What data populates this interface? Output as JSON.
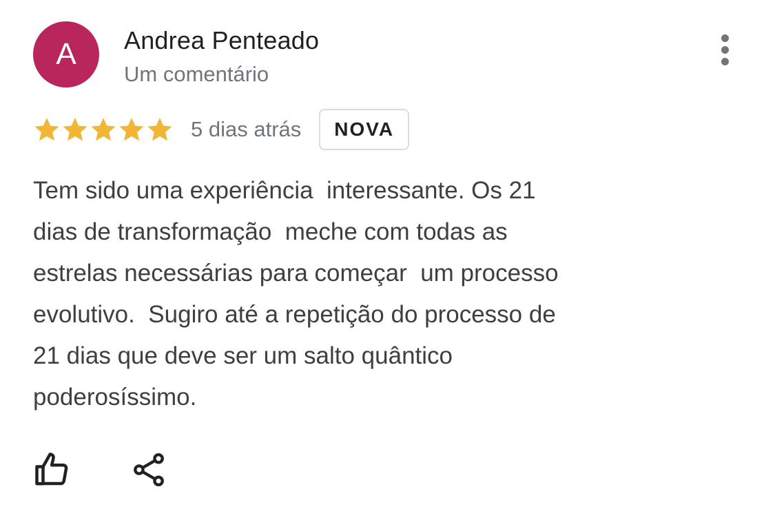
{
  "review": {
    "avatar_letter": "A",
    "author_name": "Andrea Penteado",
    "author_subtitle": "Um comentário",
    "rating": 5,
    "rating_max": 5,
    "date": "5 dias atrás",
    "badge": "NOVA",
    "text": "Tem sido uma experiência  interessante. Os 21\ndias de transformação  meche com todas as\nestrelas necessárias para começar  um processo\nevolutivo.  Sugiro até a repetição do processo de\n21 dias que deve ser um salto quântico\npoderosíssimo."
  },
  "icons": {
    "menu": "more-vert-icon",
    "star": "star-icon",
    "like": "thumb-up-icon",
    "share": "share-icon"
  },
  "colors": {
    "avatar_bg": "#b8265b",
    "star": "#f2b636",
    "secondary_text": "#70757a"
  }
}
